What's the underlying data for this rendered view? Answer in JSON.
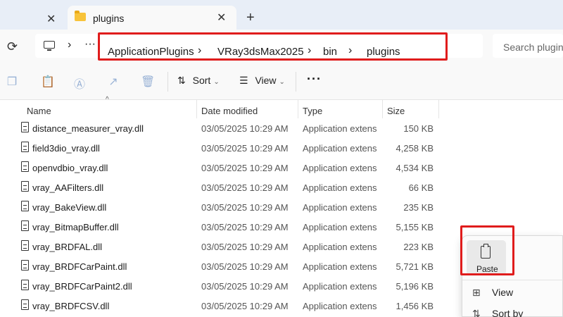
{
  "tabs": {
    "active_label": "plugins",
    "close_glyph": "✕",
    "new_tab_glyph": "+"
  },
  "address": {
    "overflow": "···",
    "chevron": "›",
    "breadcrumbs": [
      "ApplicationPlugins",
      "VRay3dsMax2025",
      "bin",
      "plugins"
    ],
    "search_placeholder": "Search plugins"
  },
  "toolbar": {
    "sort_label": "Sort",
    "view_label": "View",
    "more_label": "···",
    "icons": [
      "copy-icon",
      "paste-icon",
      "rename-icon",
      "share-icon",
      "delete-icon"
    ]
  },
  "columns": {
    "name": "Name",
    "date": "Date modified",
    "type": "Type",
    "size": "Size"
  },
  "files": [
    {
      "name": "distance_measurer_vray.dll",
      "date": "03/05/2025 10:29 AM",
      "type": "Application extens...",
      "size": "150 KB"
    },
    {
      "name": "field3dio_vray.dll",
      "date": "03/05/2025 10:29 AM",
      "type": "Application extens...",
      "size": "4,258 KB"
    },
    {
      "name": "openvdbio_vray.dll",
      "date": "03/05/2025 10:29 AM",
      "type": "Application extens...",
      "size": "4,534 KB"
    },
    {
      "name": "vray_AAFilters.dll",
      "date": "03/05/2025 10:29 AM",
      "type": "Application extens...",
      "size": "66 KB"
    },
    {
      "name": "vray_BakeView.dll",
      "date": "03/05/2025 10:29 AM",
      "type": "Application extens...",
      "size": "235 KB"
    },
    {
      "name": "vray_BitmapBuffer.dll",
      "date": "03/05/2025 10:29 AM",
      "type": "Application extens...",
      "size": "5,155 KB"
    },
    {
      "name": "vray_BRDFAL.dll",
      "date": "03/05/2025 10:29 AM",
      "type": "Application extens...",
      "size": "223 KB"
    },
    {
      "name": "vray_BRDFCarPaint.dll",
      "date": "03/05/2025 10:29 AM",
      "type": "Application extens...",
      "size": "5,721 KB"
    },
    {
      "name": "vray_BRDFCarPaint2.dll",
      "date": "03/05/2025 10:29 AM",
      "type": "Application extens...",
      "size": "5,196 KB"
    },
    {
      "name": "vray_BRDFCSV.dll",
      "date": "03/05/2025 10:29 AM",
      "type": "Application extens...",
      "size": "1,456 KB"
    }
  ],
  "context_menu": {
    "paste_label": "Paste",
    "items": [
      {
        "label": "View",
        "icon": "grid-icon"
      },
      {
        "label": "Sort by",
        "icon": "sort-icon"
      }
    ]
  },
  "colors": {
    "highlight": "#e01c1c",
    "folder": "#f8c33a"
  }
}
